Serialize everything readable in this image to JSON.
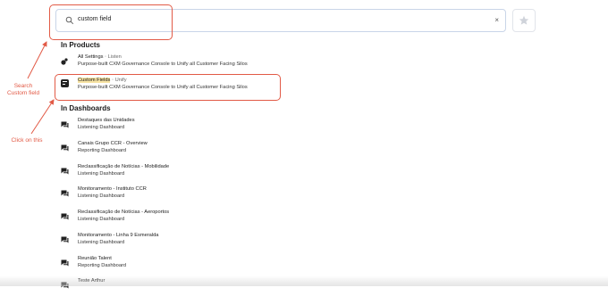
{
  "search": {
    "value": "custom field",
    "clear_glyph": "×"
  },
  "icons": {
    "search": "search-icon",
    "clear": "close-icon",
    "star": "star-icon",
    "settings": "settings-icon",
    "custom_fields": "custom-fields-icon",
    "dashboard": "chat-bubble-icon"
  },
  "colors": {
    "annotation": "#e25a46",
    "highlight": "#f7e3a3",
    "search_border": "#c9d5e8"
  },
  "annotations": {
    "search_label_line1": "Search",
    "search_label_line2": "Custom field",
    "click_label": "Click on this"
  },
  "products": {
    "heading": "In Products",
    "items": [
      {
        "title": "All Settings",
        "separator": "◦",
        "tag": "Listen",
        "subtitle": "Purpose-built CXM Governance Console to Unify all Customer Facing Silos"
      },
      {
        "title": "Custom Fields",
        "separator": "◦",
        "tag": "Unify",
        "subtitle": "Purpose-built CXM Governance Console to Unify all Customer Facing Silos"
      }
    ]
  },
  "dashboards": {
    "heading": "In Dashboards",
    "items": [
      {
        "title": "Destaques das Unidades",
        "subtitle": "Listening Dashboard"
      },
      {
        "title": "Canais Grupo CCR - Overview",
        "subtitle": "Reporting Dashboard"
      },
      {
        "title": "Reclassificação de Notícias - Mobilidade",
        "subtitle": "Listening Dashboard"
      },
      {
        "title": "Monitoramento - Instituto CCR",
        "subtitle": "Listening Dashboard"
      },
      {
        "title": "Reclassificação de Notícias - Aeroportos",
        "subtitle": "Listening Dashboard"
      },
      {
        "title": "Monitoramento - Linha 9 Esmeralda",
        "subtitle": "Listening Dashboard"
      },
      {
        "title": "Reunião Talent",
        "subtitle": "Reporting Dashboard"
      },
      {
        "title": "Teste Arthur",
        "subtitle": ""
      }
    ]
  }
}
